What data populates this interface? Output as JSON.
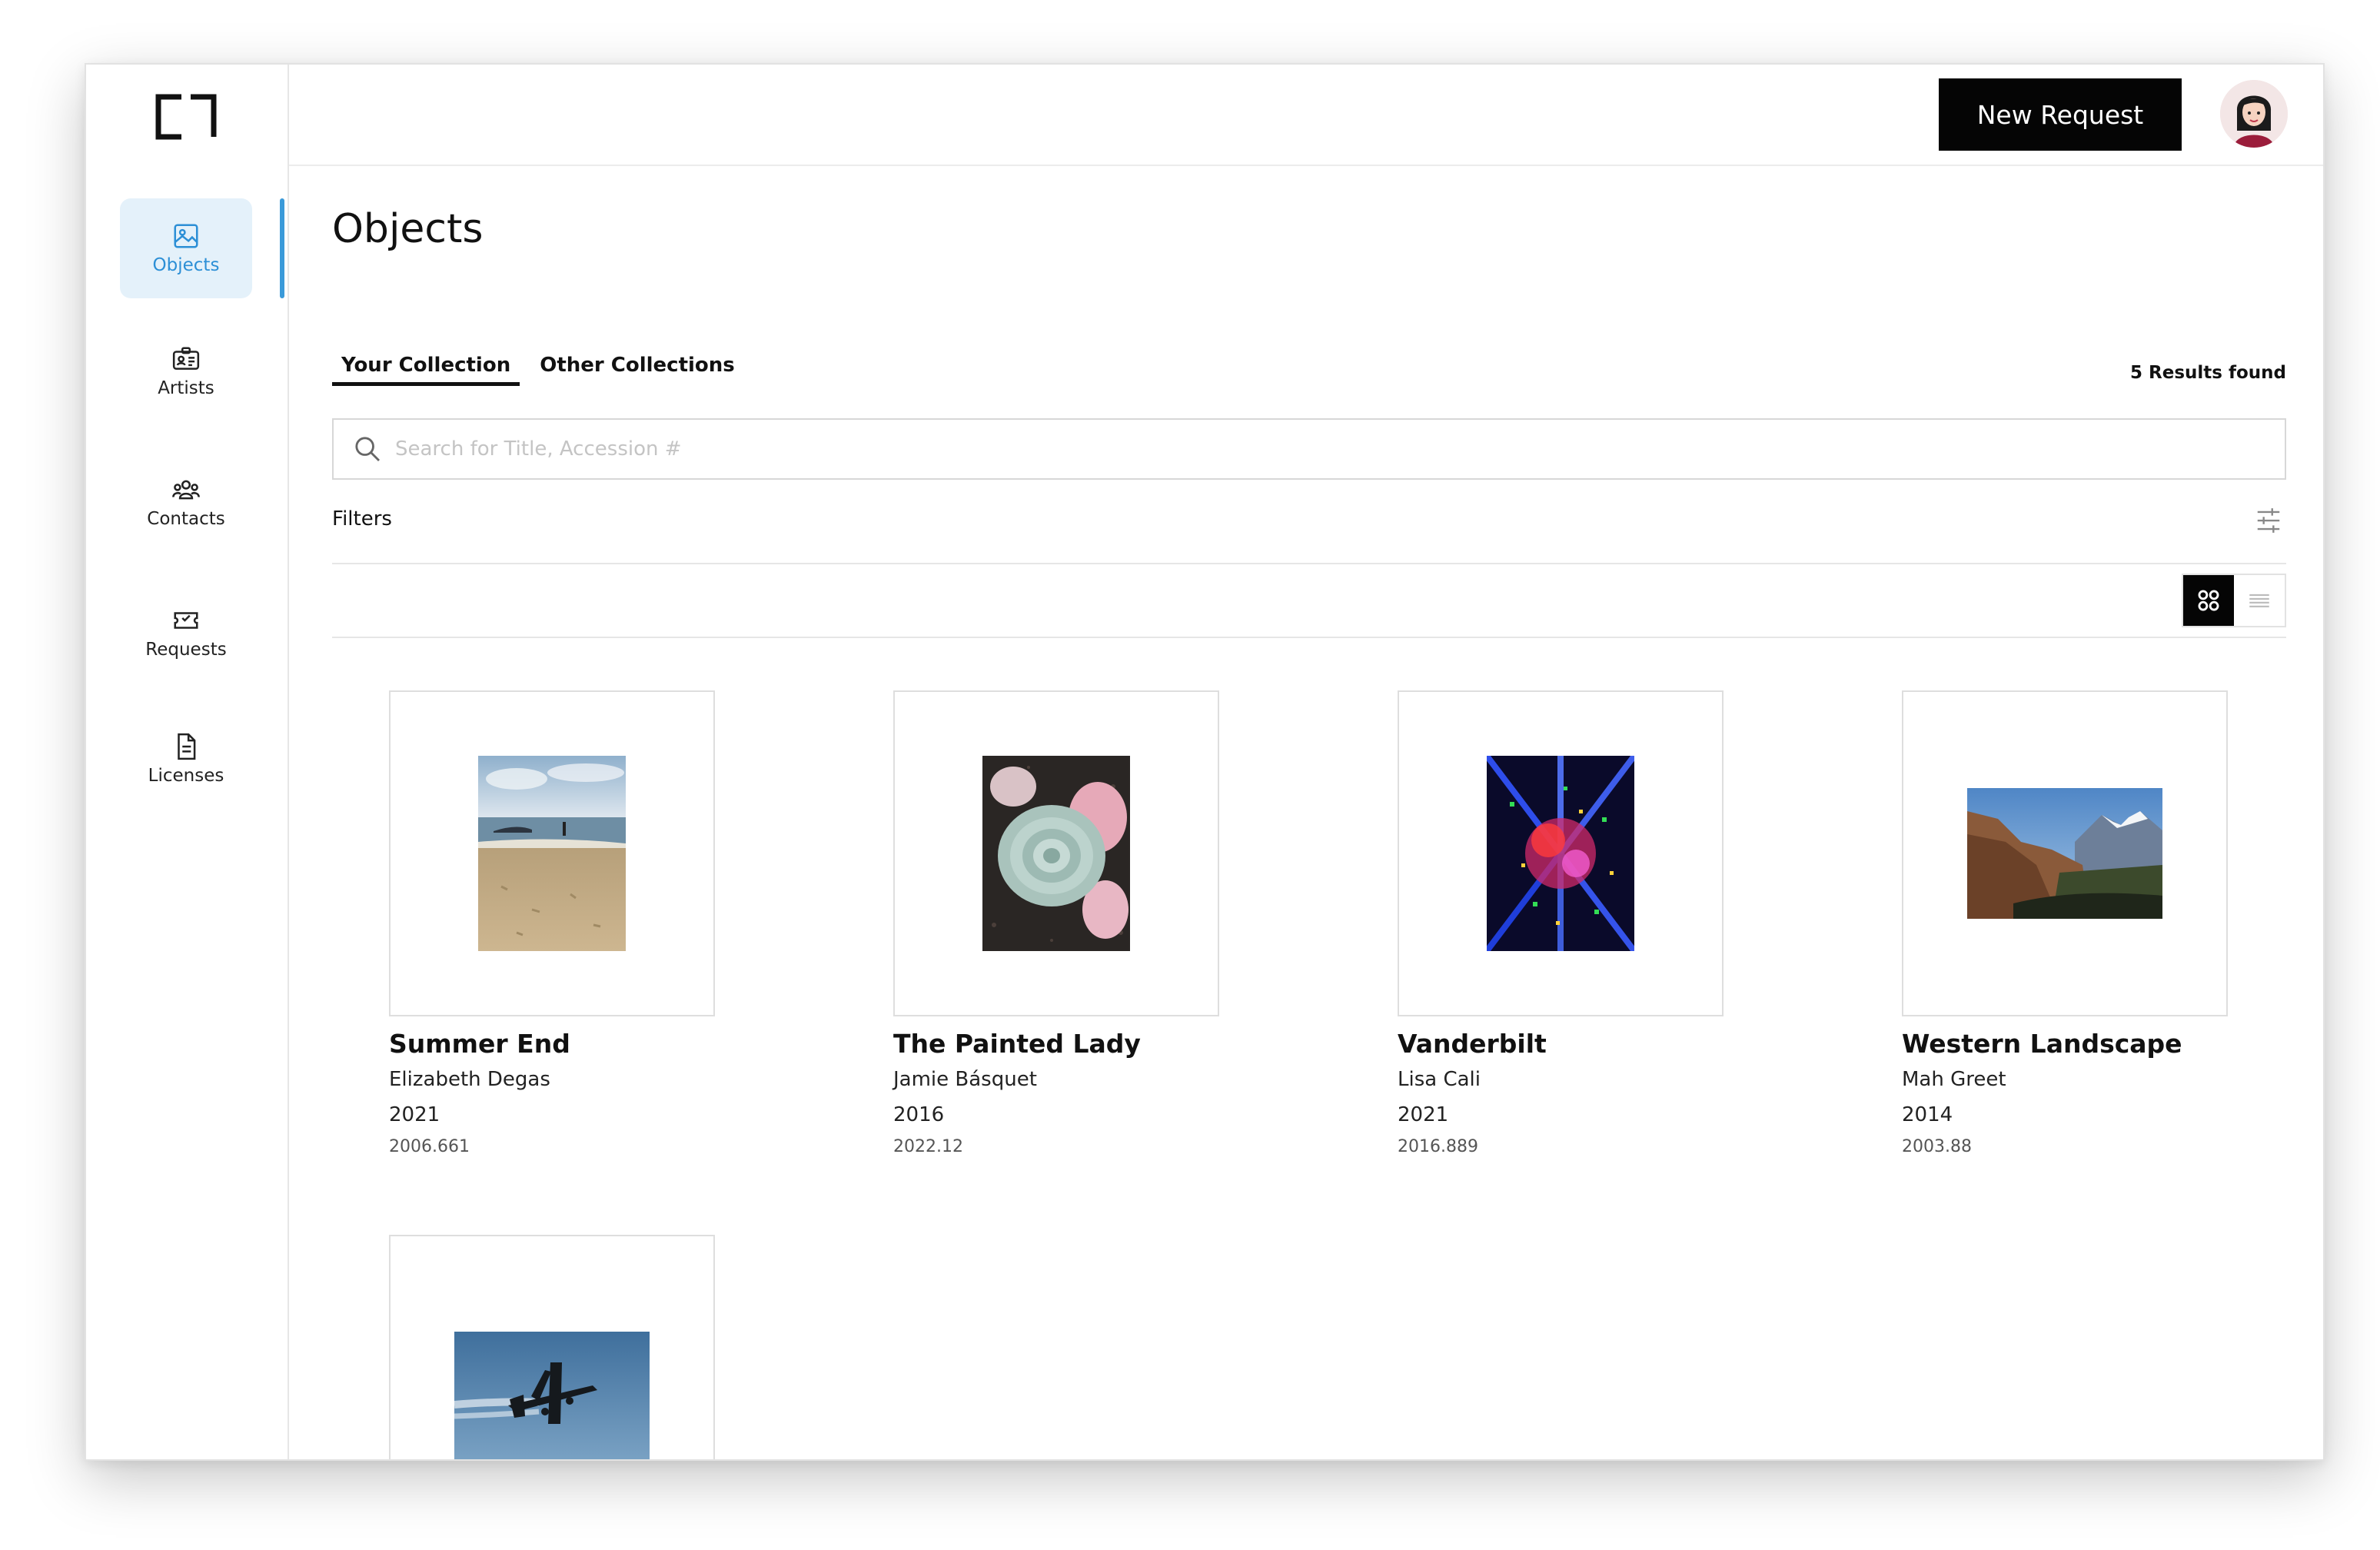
{
  "sidebar": {
    "logo": "app-logo",
    "items": [
      {
        "label": "Objects",
        "icon": "image-icon",
        "active": true
      },
      {
        "label": "Artists",
        "icon": "id-card-icon",
        "active": false
      },
      {
        "label": "Contacts",
        "icon": "people-group-icon",
        "active": false
      },
      {
        "label": "Requests",
        "icon": "ticket-icon",
        "active": false
      },
      {
        "label": "Licenses",
        "icon": "document-icon",
        "active": false
      }
    ],
    "accent_color": "#3a9ad9"
  },
  "header": {
    "new_request_label": "New Request",
    "avatar": "user-avatar"
  },
  "main": {
    "title": "Objects",
    "tabs": [
      {
        "label": "Your Collection",
        "active": true
      },
      {
        "label": "Other Collections",
        "active": false
      }
    ],
    "results_count": "5 Results found",
    "search": {
      "placeholder": "Search for Title, Accession #",
      "value": ""
    },
    "filters_label": "Filters",
    "view_mode": "grid",
    "objects": [
      {
        "title": "Summer End",
        "artist": "Elizabeth Degas",
        "year": "2021",
        "accession": "2006.661",
        "image": "beach-photo"
      },
      {
        "title": "The Painted Lady",
        "artist": "Jamie Básquet",
        "year": "2016",
        "accession": "2022.12",
        "image": "succulent-photo"
      },
      {
        "title": "Vanderbilt",
        "artist": "Lisa Cali",
        "year": "2021",
        "accession": "2016.889",
        "image": "abstract-lights-photo"
      },
      {
        "title": "Western Landscape",
        "artist": "Mah Greet",
        "year": "2014",
        "accession": "2003.88",
        "image": "canyon-landscape-photo"
      },
      {
        "title": "",
        "artist": "",
        "year": "",
        "accession": "",
        "image": "airplane-photo"
      }
    ]
  }
}
